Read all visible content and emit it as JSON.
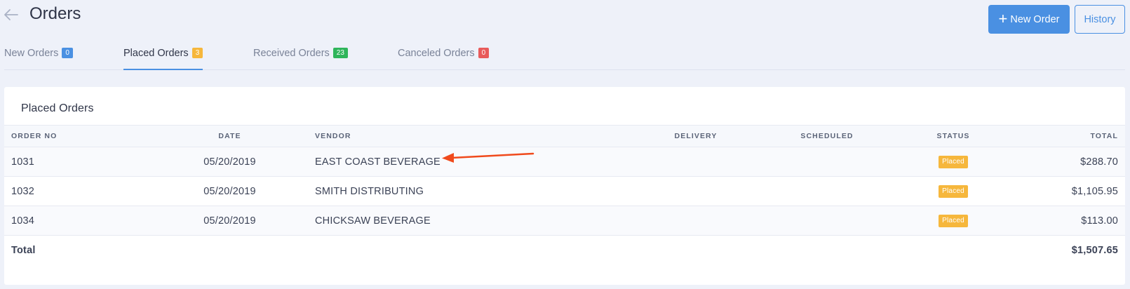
{
  "header": {
    "title": "Orders",
    "new_order_label": "New Order",
    "history_label": "History"
  },
  "icons": {
    "back": "arrow-left-icon",
    "plus": "plus-icon"
  },
  "tabs": [
    {
      "label": "New Orders",
      "count": "0",
      "color": "#4a90e2"
    },
    {
      "label": "Placed Orders",
      "count": "3",
      "color": "#f6b73c"
    },
    {
      "label": "Received Orders",
      "count": "23",
      "color": "#2fb55b"
    },
    {
      "label": "Canceled Orders",
      "count": "0",
      "color": "#e85b5b"
    }
  ],
  "active_tab": "Placed Orders",
  "card": {
    "title": "Placed Orders",
    "columns": {
      "order_no": "ORDER NO",
      "date": "DATE",
      "vendor": "VENDOR",
      "delivery": "DELIVERY",
      "scheduled": "SCHEDULED",
      "status": "STATUS",
      "total": "TOTAL"
    },
    "rows": [
      {
        "order_no": "1031",
        "date": "05/20/2019",
        "vendor": "EAST COAST BEVERAGE",
        "delivery": "",
        "scheduled": "",
        "status": "Placed",
        "total": "$288.70"
      },
      {
        "order_no": "1032",
        "date": "05/20/2019",
        "vendor": "SMITH DISTRIBUTING",
        "delivery": "",
        "scheduled": "",
        "status": "Placed",
        "total": "$1,105.95"
      },
      {
        "order_no": "1034",
        "date": "05/20/2019",
        "vendor": "CHICKSAW BEVERAGE",
        "delivery": "",
        "scheduled": "",
        "status": "Placed",
        "total": "$113.00"
      }
    ],
    "footer": {
      "label": "Total",
      "total": "$1,507.65"
    }
  },
  "colors": {
    "accent": "#4a90e2",
    "status_placed": "#f6b73c",
    "annotation_arrow": "#f04a1c"
  }
}
